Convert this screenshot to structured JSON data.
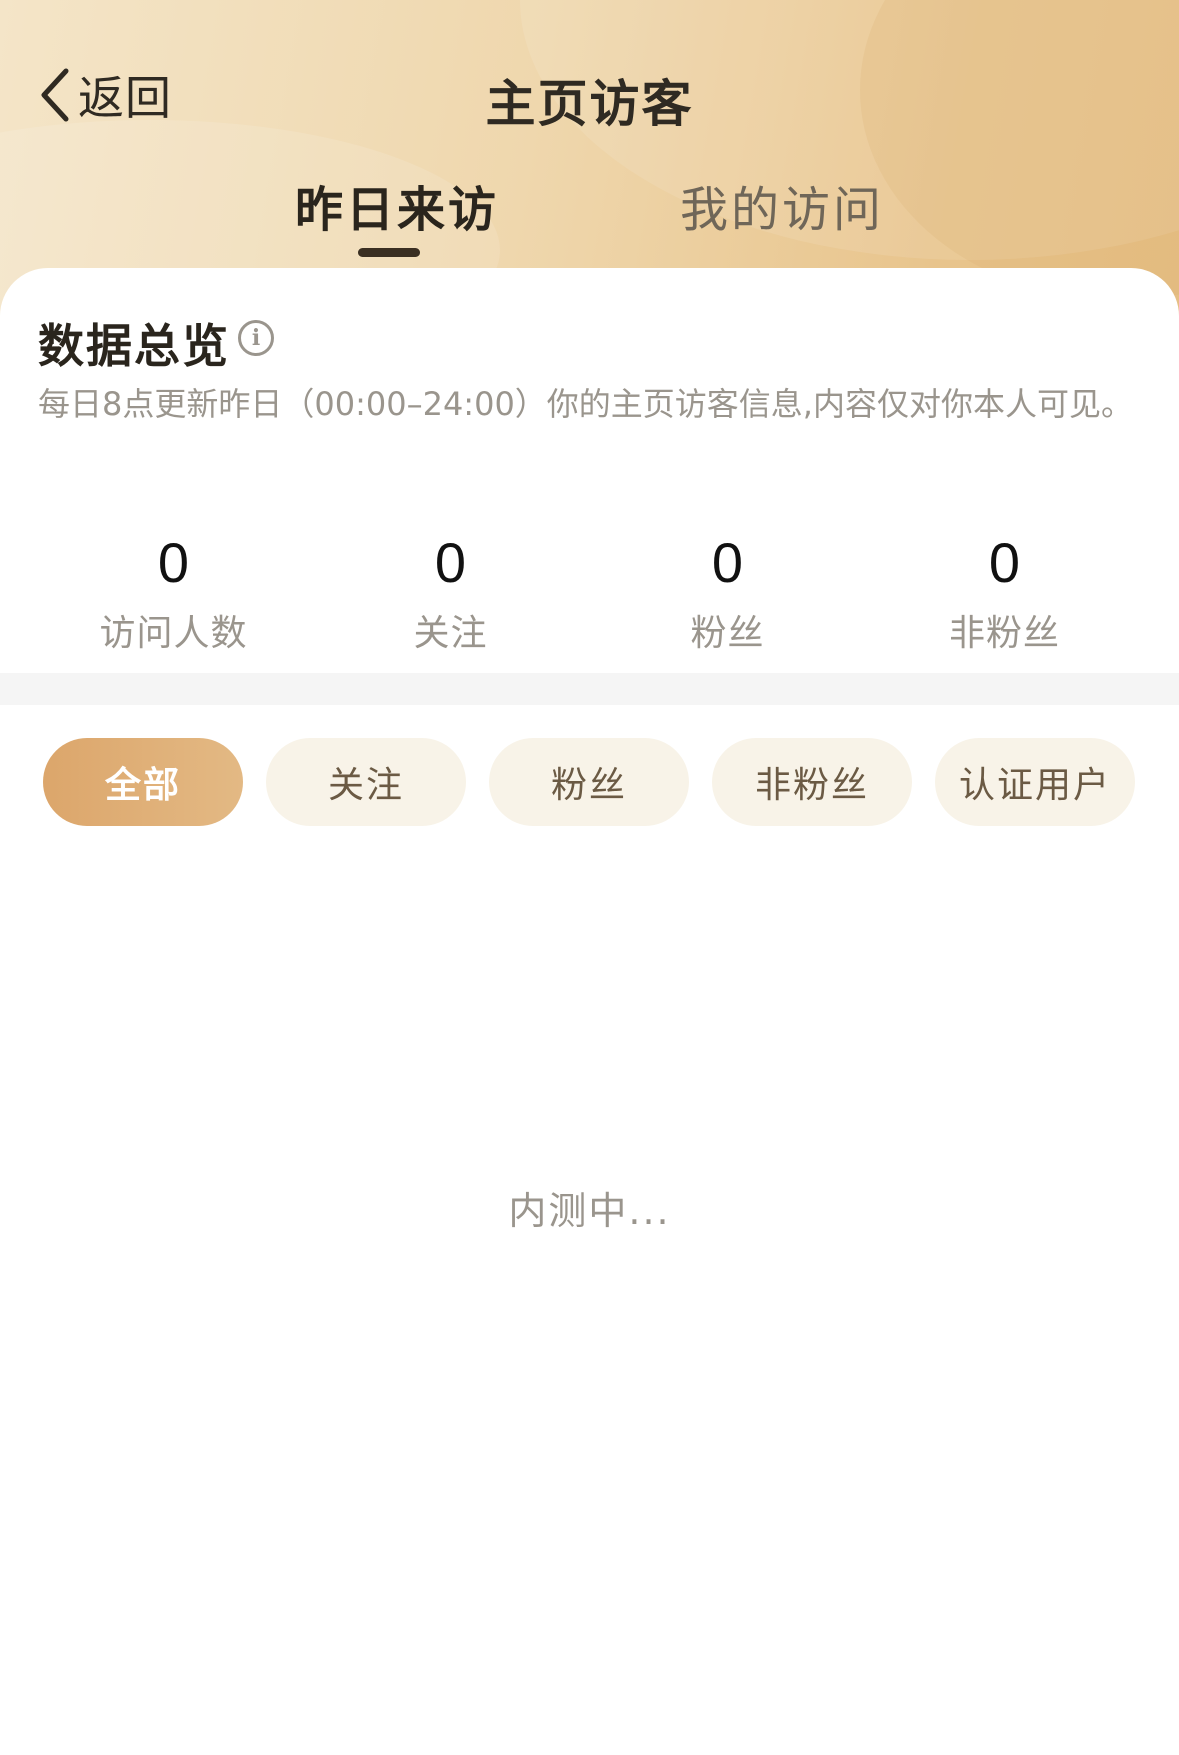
{
  "header": {
    "back_label": "返回",
    "title": "主页访客"
  },
  "tabs": [
    {
      "label": "昨日来访",
      "active": true
    },
    {
      "label": "我的访问",
      "active": false
    }
  ],
  "overview": {
    "title": "数据总览",
    "info_icon": "info-icon",
    "description": "每日8点更新昨日（00:00–24:00）你的主页访客信息,内容仅对你本人可见。"
  },
  "stats": [
    {
      "value": "0",
      "label": "访问人数"
    },
    {
      "value": "0",
      "label": "关注"
    },
    {
      "value": "0",
      "label": "粉丝"
    },
    {
      "value": "0",
      "label": "非粉丝"
    }
  ],
  "filters": [
    {
      "label": "全部",
      "active": true
    },
    {
      "label": "关注",
      "active": false
    },
    {
      "label": "粉丝",
      "active": false
    },
    {
      "label": "非粉丝",
      "active": false
    },
    {
      "label": "认证用户",
      "active": false
    }
  ],
  "empty_state": "内测中...",
  "colors": {
    "accent": "#dca66b",
    "header_gradient_start": "#f4e5c8",
    "header_gradient_end": "#e6bf85",
    "text_primary": "#2a251d",
    "text_secondary": "#9a958d"
  }
}
